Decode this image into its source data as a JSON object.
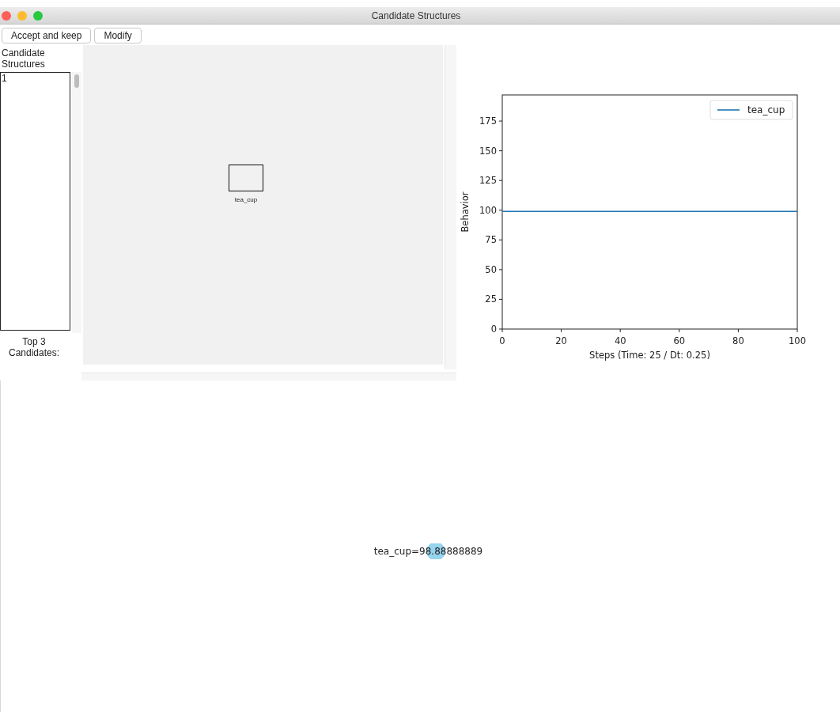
{
  "window": {
    "title": "Candidate Structures"
  },
  "toolbar": {
    "buttons": [
      "Accept and keep",
      "Modify"
    ]
  },
  "candidate_list": {
    "label": "Candidate Structures",
    "items": [
      {
        "label": "1",
        "selected": false
      }
    ]
  },
  "top_candidates": {
    "label": "Top 3 Candidates:"
  },
  "structure_canvas": {
    "nodes": [
      {
        "label": "tea_cup"
      }
    ]
  },
  "behavior_chart": {
    "chart_data": {
      "type": "line",
      "xlabel": "Steps (Time: 25 / Dt: 0.25)",
      "ylabel": "Behavior",
      "x": [
        0,
        100
      ],
      "xlim": [
        0,
        100
      ],
      "ylim": [
        0,
        197
      ],
      "xticks": [
        0,
        20,
        40,
        60,
        80,
        100
      ],
      "yticks": [
        0,
        25,
        50,
        75,
        100,
        125,
        150,
        175
      ],
      "series": [
        {
          "name": "tea_cup",
          "color": "#1f77b4",
          "values": [
            99,
            99
          ]
        }
      ]
    }
  },
  "value_graph": {
    "nodes": [
      {
        "label": "tea_cup=98.88888889"
      }
    ]
  }
}
